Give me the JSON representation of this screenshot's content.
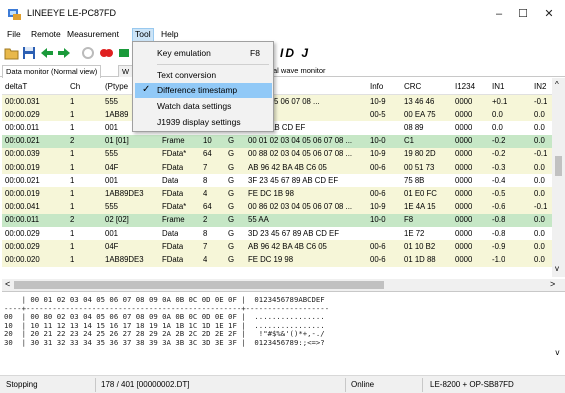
{
  "window": {
    "title": "LINEEYE LE-PC87FD",
    "minimize": "–",
    "maximize": "☐",
    "close": "✕"
  },
  "menu": [
    "File",
    "Remote",
    "Measurement",
    "Tool",
    "Help"
  ],
  "toolbar": {
    "partial_text": "ID J"
  },
  "tabs": [
    "Data monitor (Normal view)",
    "W",
    "al wave monitor"
  ],
  "tool_menu": {
    "items": [
      {
        "label": "Key emulation",
        "shortcut": "F8",
        "checked": false,
        "highlighted": false
      },
      {
        "label": "Text conversion",
        "shortcut": "",
        "checked": false,
        "highlighted": false
      },
      {
        "label": "Difference timestamp",
        "shortcut": "",
        "checked": true,
        "highlighted": true
      },
      {
        "label": "Watch data settings",
        "shortcut": "",
        "checked": false,
        "highlighted": false
      },
      {
        "label": "J1939 display settings",
        "shortcut": "",
        "checked": false,
        "highlighted": false
      }
    ],
    "check_glyph": "✓"
  },
  "grid": {
    "columns": [
      "deltaT",
      "Ch",
      "(Ptype",
      "",
      "",
      "",
      "",
      "Info",
      "CRC",
      "I1234",
      "IN1",
      "IN2"
    ],
    "rows": [
      {
        "c": [
          "00:00.031",
          "1",
          "555",
          "",
          "",
          "",
          "03 04 05 06 07 08 ...",
          "10-9",
          "13 46 46",
          "0000",
          "+0.1",
          "-0.1"
        ],
        "bg": "yellow"
      },
      {
        "c": [
          "00:00.029",
          "1",
          "1AB89",
          "",
          "",
          "",
          "98",
          "00-5",
          "00 EA 75",
          "0000",
          "0.0",
          "0.0"
        ],
        "bg": "yellow"
      },
      {
        "c": [
          "00:00.011",
          "1",
          "001",
          "",
          "",
          "",
          "67 89 AB CD EF",
          "",
          "08 89",
          "0000",
          "0.0",
          "0.0"
        ],
        "bg": "white"
      },
      {
        "c": [
          "00:00.021",
          "2",
          "01 [01]",
          "Frame",
          "10",
          "G",
          "00 01 02 03 04 05 06 07 08 ...",
          "10-0",
          "C1",
          "0000",
          "-0.2",
          "0.0"
        ],
        "bg": "green"
      },
      {
        "c": [
          "00:00.039",
          "1",
          "555",
          "FData*",
          "64",
          "G",
          "00 88 02 03 04 05 06 07 08 ...",
          "10-9",
          "19 80 2D",
          "0000",
          "-0.2",
          "-0.1"
        ],
        "bg": "yellow"
      },
      {
        "c": [
          "00:00.019",
          "1",
          "04F",
          "FData",
          "7",
          "G",
          "AB 96 42 BA 4B C6 05",
          "00-6",
          "00 51 73",
          "0000",
          "-0.3",
          "0.0"
        ],
        "bg": "yellow"
      },
      {
        "c": [
          "00:00.021",
          "1",
          "001",
          "Data",
          "8",
          "G",
          "3F 23 45 67 89 AB CD EF",
          "",
          "75 8B",
          "0000",
          "-0.4",
          "0.0"
        ],
        "bg": "white"
      },
      {
        "c": [
          "00:00.019",
          "1",
          "1AB89DE3",
          "FData",
          "4",
          "G",
          "FE DC 1B 98",
          "00-6",
          "01 E0 FC",
          "0000",
          "-0.5",
          "0.0"
        ],
        "bg": "yellow"
      },
      {
        "c": [
          "00:00.041",
          "1",
          "555",
          "FData*",
          "64",
          "G",
          "00 86 02 03 04 05 06 07 08 ...",
          "10-9",
          "1E 4A 15",
          "0000",
          "-0.6",
          "-0.1"
        ],
        "bg": "yellow"
      },
      {
        "c": [
          "00:00.011",
          "2",
          "02 [02]",
          "Frame",
          "2",
          "G",
          "55 AA",
          "10-0",
          "F8",
          "0000",
          "-0.8",
          "0.0"
        ],
        "bg": "green"
      },
      {
        "c": [
          "00:00.029",
          "1",
          "001",
          "Data",
          "8",
          "G",
          "3D 23 45 67 89 AB CD EF",
          "",
          "1E 72",
          "0000",
          "-0.8",
          "0.0"
        ],
        "bg": "white"
      },
      {
        "c": [
          "00:00.029",
          "1",
          "04F",
          "FData",
          "7",
          "G",
          "AB 96 42 BA 4B C6 05",
          "00-6",
          "01 10 B2",
          "0000",
          "-0.9",
          "0.0"
        ],
        "bg": "yellow"
      },
      {
        "c": [
          "00:00.020",
          "1",
          "1AB89DE3",
          "FData",
          "4",
          "G",
          "FE DC 19 98",
          "00-6",
          "01 1D 88",
          "0000",
          "-1.0",
          "0.0"
        ],
        "bg": "yellow"
      }
    ]
  },
  "hex": {
    "lines": [
      "    | 00 01 02 03 04 05 06 07 08 09 0A 0B 0C 0D 0E 0F |  0123456789ABCDEF",
      "----+-------------------------------------------------+-------------------",
      "00  | 00 80 02 03 04 05 06 07 08 09 0A 0B 0C 0D 0E 0F |  ................",
      "10  | 10 11 12 13 14 15 16 17 18 19 1A 1B 1C 1D 1E 1F |  ................",
      "20  | 20 21 22 23 24 25 26 27 28 29 2A 2B 2C 2D 2E 2F |   !\"#$%&'()*+,-./",
      "30  | 30 31 32 33 34 35 36 37 38 39 3A 3B 3C 3D 3E 3F |  0123456789:;<=>?"
    ]
  },
  "status": {
    "state": "Stopping",
    "position": "178 / 401 [00000002.DT]",
    "connection": "Online",
    "device": "LE-8200 + OP-SB87FD"
  },
  "colors": {
    "row_yellow": "#f6f6d8",
    "row_green": "#c6e7c6",
    "menu_highlight": "#91c9f7"
  }
}
